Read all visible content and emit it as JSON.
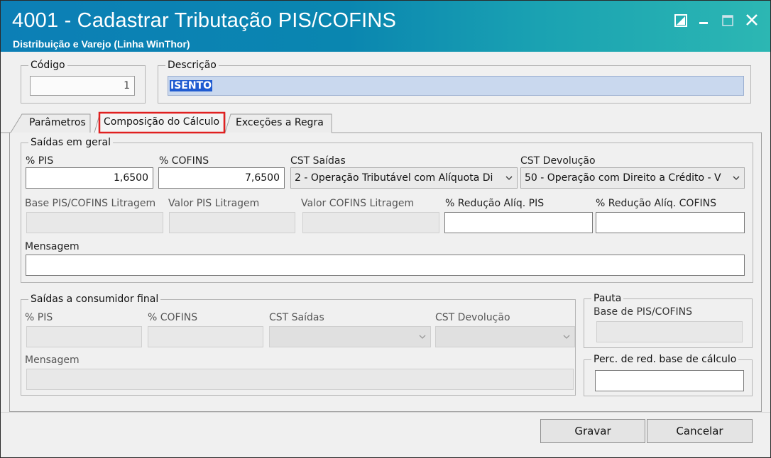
{
  "window": {
    "title": "4001 - Cadastrar Tributação PIS/COFINS",
    "subtitle": "Distribuição e Varejo (Linha WinThor)",
    "icons": [
      "restore-screen-icon",
      "minimize-icon",
      "maximize-icon",
      "close-icon"
    ]
  },
  "header": {
    "codigo_label": "Código",
    "codigo_value": "1",
    "descricao_label": "Descrição",
    "descricao_value": "ISENTO"
  },
  "tabs": [
    {
      "label": "Parâmetros",
      "active": false
    },
    {
      "label": "Composição do Cálculo",
      "active": true,
      "highlight_color": "#e02020"
    },
    {
      "label": "Exceções a Regra",
      "active": false
    }
  ],
  "saidas_geral": {
    "group_label": "Saídas em geral",
    "pis_label": "% PIS",
    "pis_value": "1,6500",
    "cofins_label": "% COFINS",
    "cofins_value": "7,6500",
    "cst_saidas_label": "CST Saídas",
    "cst_saidas_value": "2 - Operação Tributável com Alíquota Di",
    "cst_devolucao_label": "CST Devolução",
    "cst_devolucao_value": "50 - Operação com Direito a Crédito - V",
    "base_litragem_label": "Base PIS/COFINS Litragem",
    "valor_pis_litragem_label": "Valor PIS Litragem",
    "valor_cofins_litragem_label": "Valor COFINS Litragem",
    "reducao_pis_label": "% Redução Alíq. PIS",
    "reducao_cofins_label": "% Redução Alíq. COFINS",
    "mensagem_label": "Mensagem"
  },
  "consumidor_final": {
    "group_label": "Saídas a consumidor final",
    "pis_label": "% PIS",
    "cofins_label": "% COFINS",
    "cst_saidas_label": "CST Saídas",
    "cst_devolucao_label": "CST Devolução",
    "mensagem_label": "Mensagem"
  },
  "pauta": {
    "group_label": "Pauta",
    "base_label": "Base de PIS/COFINS"
  },
  "perc_red": {
    "group_label": "Perc. de red. base de cálculo"
  },
  "buttons": {
    "gravar": "Gravar",
    "cancelar": "Cancelar"
  },
  "colors": {
    "titlebar_start": "#0c7fb6",
    "titlebar_end": "#2cb7b3",
    "selection": "#3a7fd5",
    "tab_highlight": "#e02020"
  }
}
